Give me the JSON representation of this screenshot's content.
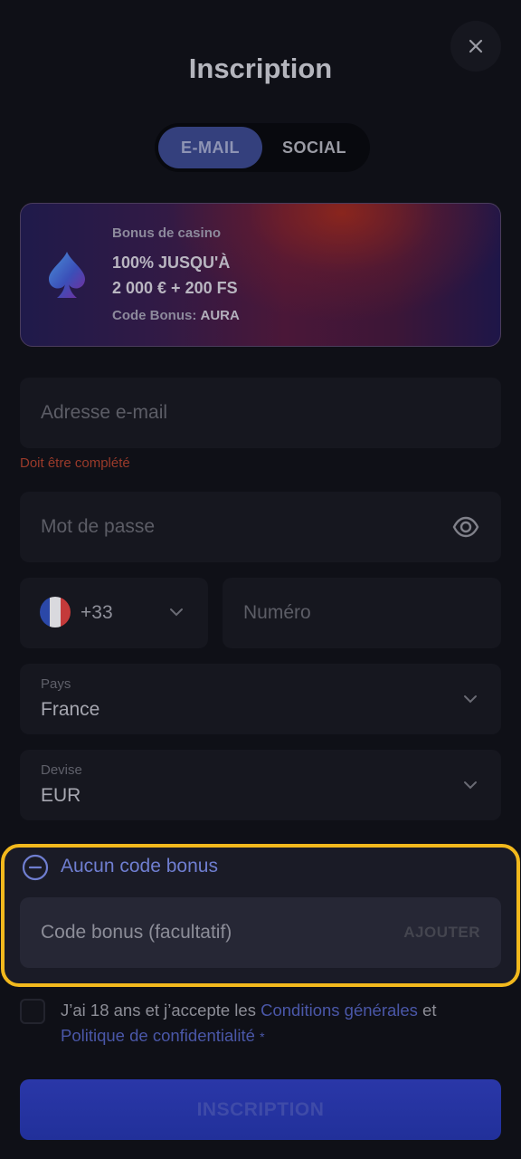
{
  "header": {
    "title": "Inscription",
    "close_icon": "close-icon"
  },
  "tabs": [
    {
      "label": "E-MAIL",
      "active": true
    },
    {
      "label": "SOCIAL",
      "active": false
    }
  ],
  "bonus_banner": {
    "label": "Bonus de casino",
    "line1": "100% JUSQU'À",
    "line2": "2 000 € + 200 FS",
    "code_label": "Code Bonus:",
    "code_value": "AURA",
    "icon": "spade-icon"
  },
  "form": {
    "email": {
      "placeholder": "Adresse e-mail",
      "value": "",
      "error": "Doit être complété"
    },
    "password": {
      "placeholder": "Mot de passe",
      "value": ""
    },
    "phone": {
      "prefix": "+33",
      "placeholder": "Numéro"
    },
    "country": {
      "label": "Pays",
      "value": "France"
    },
    "currency": {
      "label": "Devise",
      "value": "EUR"
    }
  },
  "bonus_code": {
    "toggle_label": "Aucun code bonus",
    "placeholder": "Code bonus (facultatif)",
    "add_label": "AJOUTER"
  },
  "terms": {
    "text_before": "J’ai 18 ans et j’accepte les ",
    "link1": "Conditions générales",
    "text_middle": " et ",
    "link2": "Politique de confidentialité",
    "required_mark": "*"
  },
  "submit_label": "INSCRIPTION",
  "colors": {
    "background": "#0f1017",
    "accent": "#34407d",
    "link": "#4a57a8",
    "highlight_border": "#f2b91d",
    "error": "#9a3a2a"
  }
}
